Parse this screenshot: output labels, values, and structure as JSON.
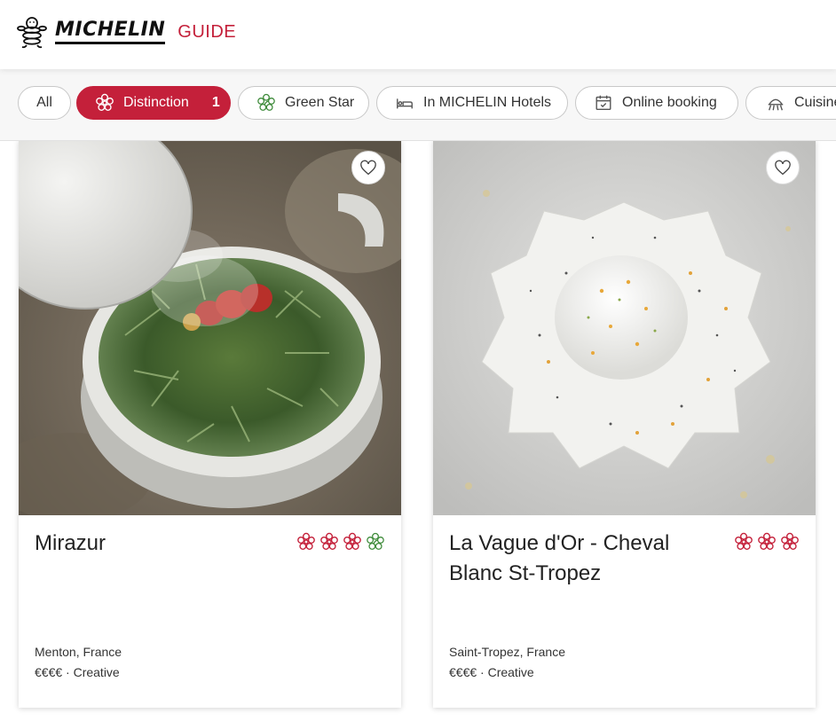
{
  "header": {
    "brand": "MICHELIN",
    "guide": "GUIDE"
  },
  "filters": [
    {
      "label": "All",
      "icon": "none",
      "active": false
    },
    {
      "label": "Distinction",
      "count": "1",
      "icon": "michelin-star-icon",
      "active": true
    },
    {
      "label": "Green Star",
      "icon": "green-star-icon",
      "active": false
    },
    {
      "label": "In MICHELIN Hotels",
      "icon": "bed-icon",
      "active": false
    },
    {
      "label": "Online booking",
      "icon": "calendar-icon",
      "active": false
    },
    {
      "label": "Cuisine",
      "icon": "chef-hat-icon",
      "active": false
    }
  ],
  "colors": {
    "accent": "#c4203a",
    "green": "#3e8b3a",
    "star": "#c4203a"
  },
  "restaurants": [
    {
      "name": "Mirazur",
      "location": "Menton, France",
      "price_cuisine": "€€€€ · Creative",
      "stars": 3,
      "green_star": true
    },
    {
      "name": "La Vague d'Or - Cheval Blanc St-Tropez",
      "location": "Saint-Tropez, France",
      "price_cuisine": "€€€€ · Creative",
      "stars": 3,
      "green_star": false
    }
  ]
}
